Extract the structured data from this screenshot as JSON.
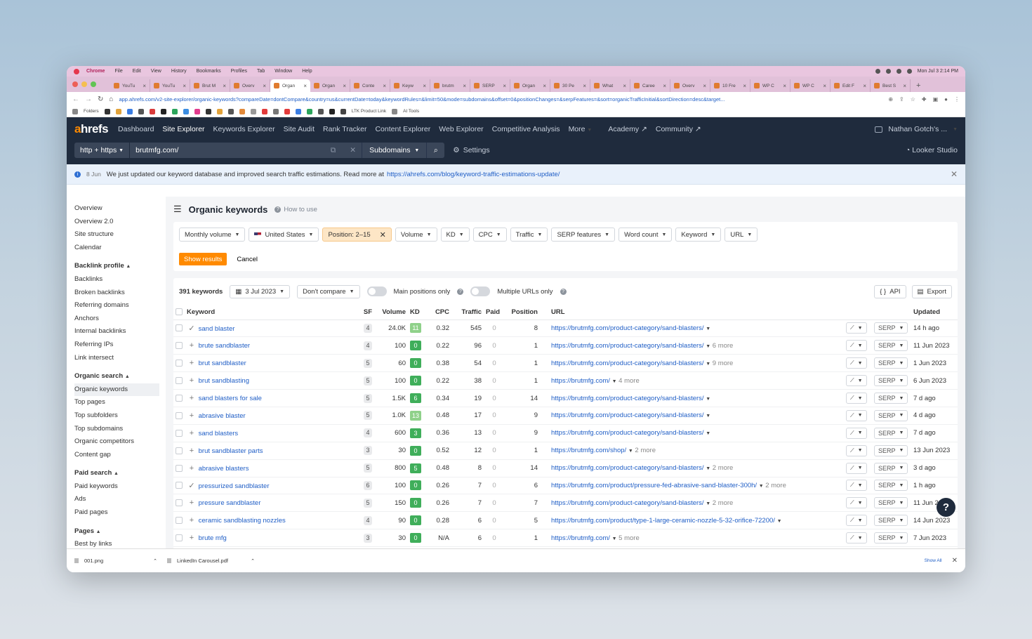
{
  "menubar": {
    "app": "Chrome",
    "items": [
      "File",
      "Edit",
      "View",
      "History",
      "Bookmarks",
      "Profiles",
      "Tab",
      "Window",
      "Help"
    ],
    "clock": "Mon Jul 3  2:14 PM"
  },
  "tabs": [
    "YouTu",
    "YouTu",
    "Brut M",
    "Overv",
    "Organ",
    "Organ",
    "Conte",
    "Keyw",
    "brutm",
    "SERP",
    "Organ",
    "30 Pe",
    "What",
    "Caree",
    "Overv",
    "10 Fre",
    "WP C",
    "WP C",
    "Edit F",
    "Best S"
  ],
  "address": {
    "url": "app.ahrefs.com/v2-site-explorer/organic-keywords?compareDate=dontCompare&country=us&currentDate=today&keywordRules=&limit=50&mode=subdomains&offset=0&positionChanges=&serpFeatures=&sort=organicTrafficInitial&sortDirection=desc&target..."
  },
  "bookmarks": [
    "Folders",
    "LTK Product Link",
    "AI Tools"
  ],
  "nav": {
    "logo_a": "a",
    "logo_rest": "hrefs",
    "items": [
      "Dashboard",
      "Site Explorer",
      "Keywords Explorer",
      "Site Audit",
      "Rank Tracker",
      "Content Explorer",
      "Web Explorer",
      "Competitive Analysis",
      "More"
    ],
    "academy": "Academy",
    "community": "Community",
    "user": "Nathan Gotch's ..."
  },
  "search": {
    "protocol": "http + https",
    "domain": "brutmfg.com/",
    "mode": "Subdomains",
    "settings": "Settings",
    "looker": "Looker Studio"
  },
  "notice": {
    "date": "8 Jun",
    "text": "We just updated our keyword database and improved search traffic estimations. Read more at",
    "link": "https://ahrefs.com/blog/keyword-traffic-estimations-update/"
  },
  "sidebar": {
    "top": [
      "Overview",
      "Overview 2.0",
      "Site structure",
      "Calendar"
    ],
    "backlink_header": "Backlink profile",
    "backlink": [
      "Backlinks",
      "Broken backlinks",
      "Referring domains",
      "Anchors",
      "Internal backlinks",
      "Referring IPs",
      "Link intersect"
    ],
    "organic_header": "Organic search",
    "organic": [
      "Organic keywords",
      "Top pages",
      "Top subfolders",
      "Top subdomains",
      "Organic competitors",
      "Content gap"
    ],
    "paid_header": "Paid search",
    "paid": [
      "Paid keywords",
      "Ads",
      "Paid pages"
    ],
    "pages_header": "Pages",
    "pages": [
      "Best by links"
    ]
  },
  "page": {
    "title": "Organic keywords",
    "how": "How to use"
  },
  "filters": {
    "volume_mode": "Monthly volume",
    "country": "United States",
    "position": "Position: 2–15",
    "others": [
      "Volume",
      "KD",
      "CPC",
      "Traffic",
      "SERP features",
      "Word count",
      "Keyword",
      "URL"
    ],
    "show": "Show results",
    "cancel": "Cancel"
  },
  "toolbar": {
    "count": "391 keywords",
    "date": "3 Jul 2023",
    "compare": "Don't compare",
    "main_positions": "Main positions only",
    "multiple_urls": "Multiple URLs only",
    "api": "API",
    "export": "Export"
  },
  "table": {
    "headers": [
      "Keyword",
      "SF",
      "Volume",
      "KD",
      "CPC",
      "Traffic",
      "Paid",
      "Position",
      "URL",
      "Updated"
    ],
    "rows": [
      {
        "mark": "✓",
        "keyword": "sand blaster",
        "sf": "4",
        "volume": "24.0K",
        "kd": "11",
        "kd_color": "#8fd18a",
        "cpc": "0.32",
        "traffic": "545",
        "paid": "0",
        "position": "8",
        "url": "https://brutmfg.com/product-category/sand-blasters/",
        "more": "",
        "updated": "14 h ago"
      },
      {
        "mark": "+",
        "keyword": "brute sandblaster",
        "sf": "4",
        "volume": "100",
        "kd": "0",
        "kd_color": "#3fae5a",
        "cpc": "0.22",
        "traffic": "96",
        "paid": "0",
        "position": "1",
        "url": "https://brutmfg.com/product-category/sand-blasters/",
        "more": "6 more",
        "updated": "11 Jun 2023"
      },
      {
        "mark": "+",
        "keyword": "brut sandblaster",
        "sf": "5",
        "volume": "60",
        "kd": "0",
        "kd_color": "#3fae5a",
        "cpc": "0.38",
        "traffic": "54",
        "paid": "0",
        "position": "1",
        "url": "https://brutmfg.com/product-category/sand-blasters/",
        "more": "9 more",
        "updated": "1 Jun 2023"
      },
      {
        "mark": "+",
        "keyword": "brut sandblasting",
        "sf": "5",
        "volume": "100",
        "kd": "0",
        "kd_color": "#3fae5a",
        "cpc": "0.22",
        "traffic": "38",
        "paid": "0",
        "position": "1",
        "url": "https://brutmfg.com/",
        "more": "4 more",
        "updated": "6 Jun 2023"
      },
      {
        "mark": "+",
        "keyword": "sand blasters for sale",
        "sf": "5",
        "volume": "1.5K",
        "kd": "6",
        "kd_color": "#3fae5a",
        "cpc": "0.34",
        "traffic": "19",
        "paid": "0",
        "position": "14",
        "url": "https://brutmfg.com/product-category/sand-blasters/",
        "more": "",
        "updated": "7 d ago"
      },
      {
        "mark": "+",
        "keyword": "abrasive blaster",
        "sf": "5",
        "volume": "1.0K",
        "kd": "13",
        "kd_color": "#8fd18a",
        "cpc": "0.48",
        "traffic": "17",
        "paid": "0",
        "position": "9",
        "url": "https://brutmfg.com/product-category/sand-blasters/",
        "more": "",
        "updated": "4 d ago"
      },
      {
        "mark": "+",
        "keyword": "sand blasters",
        "sf": "4",
        "volume": "600",
        "kd": "3",
        "kd_color": "#3fae5a",
        "cpc": "0.36",
        "traffic": "13",
        "paid": "0",
        "position": "9",
        "url": "https://brutmfg.com/product-category/sand-blasters/",
        "more": "",
        "updated": "7 d ago"
      },
      {
        "mark": "+",
        "keyword": "brut sandblaster parts",
        "sf": "3",
        "volume": "30",
        "kd": "0",
        "kd_color": "#3fae5a",
        "cpc": "0.52",
        "traffic": "12",
        "paid": "0",
        "position": "1",
        "url": "https://brutmfg.com/shop/",
        "more": "2 more",
        "updated": "13 Jun 2023"
      },
      {
        "mark": "+",
        "keyword": "abrasive blasters",
        "sf": "5",
        "volume": "800",
        "kd": "5",
        "kd_color": "#3fae5a",
        "cpc": "0.48",
        "traffic": "8",
        "paid": "0",
        "position": "14",
        "url": "https://brutmfg.com/product-category/sand-blasters/",
        "more": "2 more",
        "updated": "3 d ago"
      },
      {
        "mark": "✓",
        "keyword": "pressurized sandblaster",
        "sf": "6",
        "volume": "100",
        "kd": "0",
        "kd_color": "#3fae5a",
        "cpc": "0.26",
        "traffic": "7",
        "paid": "0",
        "position": "6",
        "url": "https://brutmfg.com/product/pressure-fed-abrasive-sand-blaster-300h/",
        "more": "2 more",
        "updated": "1 h ago"
      },
      {
        "mark": "+",
        "keyword": "pressure sandblaster",
        "sf": "5",
        "volume": "150",
        "kd": "0",
        "kd_color": "#3fae5a",
        "cpc": "0.26",
        "traffic": "7",
        "paid": "0",
        "position": "7",
        "url": "https://brutmfg.com/product-category/sand-blasters/",
        "more": "2 more",
        "updated": "11 Jun 2023"
      },
      {
        "mark": "+",
        "keyword": "ceramic sandblasting nozzles",
        "sf": "4",
        "volume": "90",
        "kd": "0",
        "kd_color": "#3fae5a",
        "cpc": "0.28",
        "traffic": "6",
        "paid": "0",
        "position": "5",
        "url": "https://brutmfg.com/product/type-1-large-ceramic-nozzle-5-32-orifice-72200/",
        "more": "",
        "updated": "14 Jun 2023"
      },
      {
        "mark": "+",
        "keyword": "brute mfg",
        "sf": "3",
        "volume": "30",
        "kd": "0",
        "kd_color": "#3fae5a",
        "cpc": "N/A",
        "traffic": "6",
        "paid": "0",
        "position": "1",
        "url": "https://brutmfg.com/",
        "more": "5 more",
        "updated": "7 Jun 2023"
      }
    ],
    "serp_label": "SERP"
  },
  "downloads": {
    "files": [
      "001.png",
      "LinkedIn Carousel.pdf"
    ],
    "show_all": "Show All"
  }
}
